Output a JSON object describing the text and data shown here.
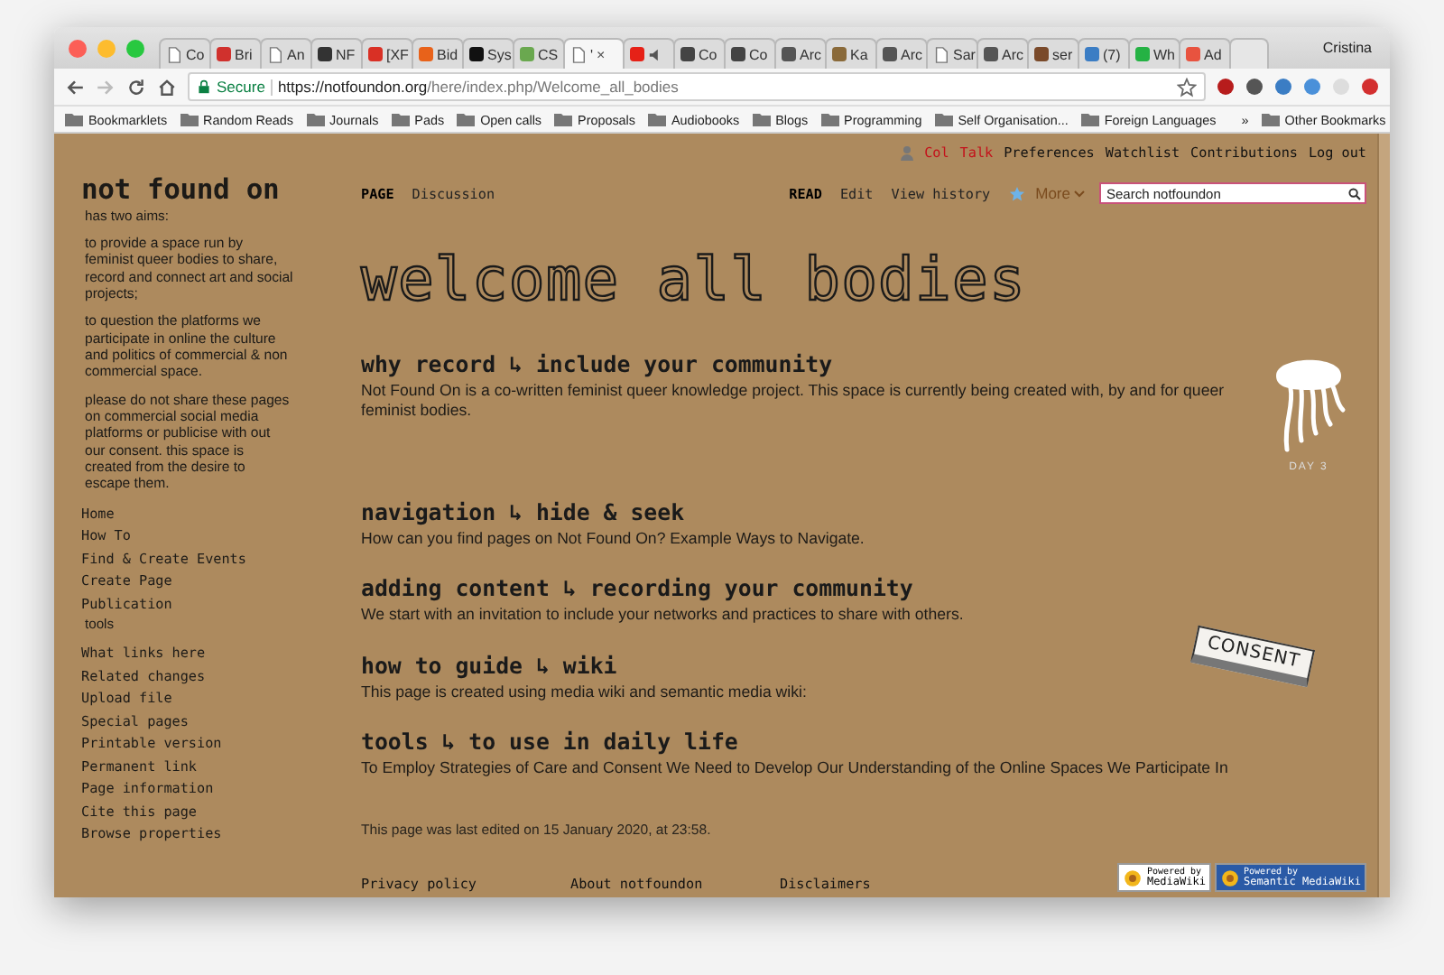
{
  "browser": {
    "tabs": [
      {
        "label": "Co",
        "selected": false,
        "audio": false
      },
      {
        "label": "Bri",
        "selected": false,
        "audio": false,
        "color": "#d0312d"
      },
      {
        "label": "An",
        "selected": false,
        "audio": false
      },
      {
        "label": "NF",
        "selected": false,
        "audio": false,
        "color": "#333333"
      },
      {
        "label": "[XF",
        "selected": false,
        "audio": false,
        "color": "#d93025"
      },
      {
        "label": "Bid",
        "selected": false,
        "audio": false,
        "color": "#e8621a"
      },
      {
        "label": "Sys",
        "selected": false,
        "audio": false,
        "color": "#111111"
      },
      {
        "label": "CS",
        "selected": false,
        "audio": false,
        "color": "#6aa84f"
      },
      {
        "label": "'",
        "selected": true,
        "audio": false
      },
      {
        "selected": false,
        "audio": true,
        "color": "#e62117"
      },
      {
        "label": "Co",
        "selected": false,
        "audio": false,
        "color": "#444444"
      },
      {
        "label": "Co",
        "selected": false,
        "audio": false,
        "color": "#444444"
      },
      {
        "label": "Arc",
        "selected": false,
        "audio": false,
        "color": "#555555"
      },
      {
        "label": "Ka",
        "selected": false,
        "audio": false,
        "color": "#8a6a3a"
      },
      {
        "label": "Arc",
        "selected": false,
        "audio": false,
        "color": "#555555"
      },
      {
        "label": "Sar",
        "selected": false,
        "audio": false
      },
      {
        "label": "Arc",
        "selected": false,
        "audio": false,
        "color": "#555555"
      },
      {
        "label": "ser",
        "selected": false,
        "audio": false,
        "color": "#7a4a2a"
      },
      {
        "label": "(7)",
        "selected": false,
        "audio": false,
        "color": "#3b7dc4"
      },
      {
        "label": "Wh",
        "selected": false,
        "audio": false,
        "color": "#25b244"
      },
      {
        "label": "Ad",
        "selected": false,
        "audio": false,
        "color": "#e8533f"
      }
    ],
    "profile": "Cristina",
    "close_tab": "×",
    "address": {
      "secure_label": "Secure",
      "host": "https://notfoundon.org",
      "path": "/here/index.php/Welcome_all_bodies"
    },
    "bookmarks": [
      "Bookmarklets",
      "Random Reads",
      "Journals",
      "Pads",
      "Open calls",
      "Proposals",
      "Audiobooks",
      "Blogs",
      "Programming",
      "Self Organisation...",
      "Foreign Languages"
    ],
    "bookmarks_overflow": "»",
    "other_bookmarks": "Other Bookmarks"
  },
  "sidebar": {
    "logo": "not found on",
    "intro": "has two aims:",
    "paragraphs": [
      "to provide a space run by feminist queer bodies to share, record and connect art and social projects;",
      "to question the platforms we participate in online the culture and politics of commercial & non commercial space.",
      "please do not share these pages on commercial social media platforms or publicise with out our consent. this space is created from the desire to escape them."
    ],
    "nav": [
      "Home",
      "How To",
      "Find & Create Events",
      "Create Page",
      "Publication"
    ],
    "tools_heading": "tools",
    "tools": [
      "What links here",
      "Related changes",
      "Upload file",
      "Special pages",
      "Printable version",
      "Permanent link",
      "Page information",
      "Cite this page",
      "Browse properties"
    ]
  },
  "user_links": [
    {
      "label": "Col",
      "missing": true
    },
    {
      "label": "Talk",
      "missing": true
    },
    {
      "label": "Preferences",
      "missing": false
    },
    {
      "label": "Watchlist",
      "missing": false
    },
    {
      "label": "Contributions",
      "missing": false
    },
    {
      "label": "Log out",
      "missing": false
    }
  ],
  "namespace_tabs": [
    {
      "label": "PAGE",
      "selected": true
    },
    {
      "label": "Discussion",
      "selected": false
    }
  ],
  "view_tabs": [
    {
      "label": "READ",
      "selected": true
    },
    {
      "label": "Edit",
      "selected": false
    },
    {
      "label": "View history",
      "selected": false
    }
  ],
  "more": "More",
  "search": {
    "placeholder": "Search notfoundon"
  },
  "title": "welcome all bodies",
  "sections": [
    {
      "heading": "why record ↳ include your community",
      "text": "Not Found On is a co-written feminist queer knowledge project. This space is currently being created with, by and for queer feminist bodies.",
      "illustration": {
        "kind": "jellyfish",
        "caption": "DAY 3"
      }
    },
    {
      "heading": "navigation ↳ hide & seek",
      "text": "How can you find pages on Not Found On? Example Ways to Navigate."
    },
    {
      "heading": "adding content ↳ recording your community",
      "text": "We start with an invitation to include your networks and practices to share with others."
    },
    {
      "heading": "how to guide ↳ wiki",
      "text": "This page is created using media wiki and semantic media wiki:",
      "illustration": {
        "kind": "eraser",
        "caption": "CONSENT"
      }
    },
    {
      "heading": "tools ↳ to use in daily life",
      "text": "To Employ Strategies of Care and Consent We Need to Develop Our Understanding of the Online Spaces We Participate In"
    }
  ],
  "footer": {
    "last_edited": "This page was last edited on 15 January 2020, at 23:58.",
    "links": [
      "Privacy policy",
      "About notfoundon",
      "Disclaimers"
    ],
    "badges": [
      {
        "small": "Powered by",
        "name": "MediaWiki"
      },
      {
        "small": "Powered by",
        "name": "Semantic MediaWiki"
      }
    ]
  }
}
